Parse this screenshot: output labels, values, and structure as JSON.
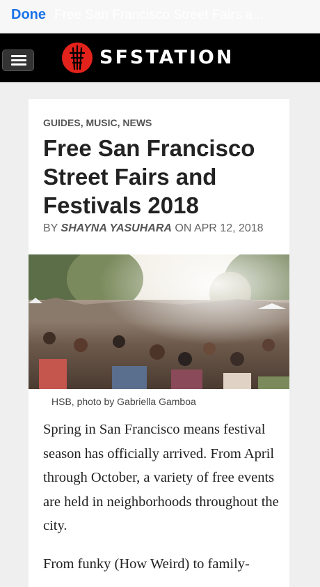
{
  "topbar": {
    "done_label": "Done",
    "page_title": "Free San Francisco Street Fairs a..."
  },
  "site": {
    "logo_text": "SFSTATION",
    "brand_color": "#e3231b"
  },
  "article": {
    "categories": [
      "GUIDES",
      "MUSIC",
      "NEWS"
    ],
    "title": "Free San Francisco Street Fairs and Festivals 2018",
    "byline_prefix": "BY",
    "author": "SHAYNA YASUHARA",
    "date_prefix": "ON",
    "date": "APR 12, 2018",
    "image_caption": "HSB, photo by Gabriella Gamboa",
    "paragraphs": [
      "Spring in San Francisco means festival season has officially arrived. From April through October, a variety of free events are held in neighborhoods throughout the city.",
      "From funky (How Weird) to family-"
    ]
  },
  "icons": {
    "menu": "hamburger-menu-icon",
    "logo": "sutro-tower-logo-icon"
  }
}
